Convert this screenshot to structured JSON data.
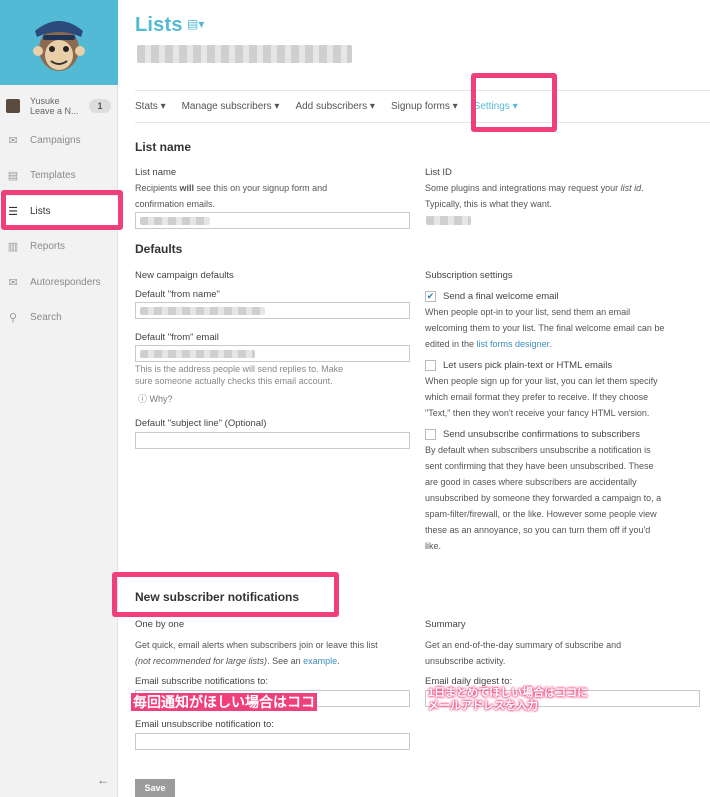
{
  "sidebar": {
    "user": {
      "name": "Yusuke",
      "sub": "Leave a N...",
      "count": "1"
    },
    "items": [
      {
        "label": "Campaigns",
        "icon": "envelope-icon"
      },
      {
        "label": "Templates",
        "icon": "template-icon"
      },
      {
        "label": "Lists",
        "icon": "list-icon"
      },
      {
        "label": "Reports",
        "icon": "chart-icon"
      },
      {
        "label": "Autoresponders",
        "icon": "autoresponder-icon"
      },
      {
        "label": "Search",
        "icon": "search-icon"
      }
    ],
    "collapse": "←"
  },
  "header": {
    "title": "Lists"
  },
  "tabs": [
    {
      "label": "Stats ▾"
    },
    {
      "label": "Manage subscribers ▾"
    },
    {
      "label": "Add subscribers ▾"
    },
    {
      "label": "Signup forms ▾"
    },
    {
      "label": "Settings ▾"
    }
  ],
  "list_name": {
    "heading": "List name",
    "name_label": "List name",
    "name_desc_1": "Recipients ",
    "name_desc_bold": "will",
    "name_desc_2": " see this on your signup form and",
    "name_desc_3": "confirmation emails.",
    "id_label": "List ID",
    "id_desc_1": "Some plugins and integrations may request your ",
    "id_desc_italic": "list id",
    "id_desc_2": ".",
    "id_desc_3": "Typically, this is what they want."
  },
  "defaults": {
    "heading": "Defaults",
    "campaign_label": "New campaign defaults",
    "from_name_label": "Default \"from name\"",
    "from_email_label": "Default \"from\" email",
    "from_email_hint_1": "This is the address people will send replies to. Make",
    "from_email_hint_2": "sure someone actually checks this email account.",
    "why": "Why?",
    "subject_label": "Default \"subject line\" (Optional)",
    "subscription_label": "Subscription settings",
    "welcome_label": "Send a final welcome email",
    "welcome_desc_1": "When people opt-in to your list, send them an email",
    "welcome_desc_2": "welcoming them to your list. The final welcome email can be",
    "welcome_desc_3": "edited in the ",
    "welcome_desc_link": "list forms designer.",
    "plain_label": "Let users pick plain-text or HTML emails",
    "plain_desc_1": "When people sign up for your list, you can let them specify",
    "plain_desc_2": "which email format they prefer to receive. If they choose",
    "plain_desc_3": "\"Text,\" then they won't receive your fancy HTML version.",
    "unsub_label": "Send unsubscribe confirmations to subscribers",
    "unsub_desc_1": "By default when subscribers unsubscribe a notification is",
    "unsub_desc_2": "sent confirming that they have been unsubscribed. These",
    "unsub_desc_3": "are good in cases where subscribers are accidentally",
    "unsub_desc_4": "unsubscribed by someone they forwarded a campaign to, a",
    "unsub_desc_5": "spam-filter/firewall, or the like. However some people view",
    "unsub_desc_6": "these as an annoyance, so you can turn them off if you'd",
    "unsub_desc_7": "like."
  },
  "notifications": {
    "heading": "New subscriber notifications",
    "one_label": "One by one",
    "one_desc_1": "Get quick, email alerts when subscribers join or leave this list",
    "one_desc_italic": "(not recommended for large lists)",
    "one_desc_2": ". See an ",
    "one_desc_link": "example",
    "one_desc_3": ".",
    "summary_label": "Summary",
    "summary_desc_1": "Get an end-of-the-day summary of subscribe and",
    "summary_desc_2": "unsubscribe activity.",
    "sub_notif_label": "Email subscribe notifications to:",
    "unsub_notif_label": "Email unsubscribe notification to:",
    "digest_label": "Email daily digest to:",
    "note_left": "毎回通知がほしい場合はココ",
    "note_right_1": "1日まとめてほしい場合はココに",
    "note_right_2": "メールアドレスを入力"
  },
  "save_label": "Save",
  "colors": {
    "accent": "#52bad5",
    "highlight": "#f0407b"
  }
}
